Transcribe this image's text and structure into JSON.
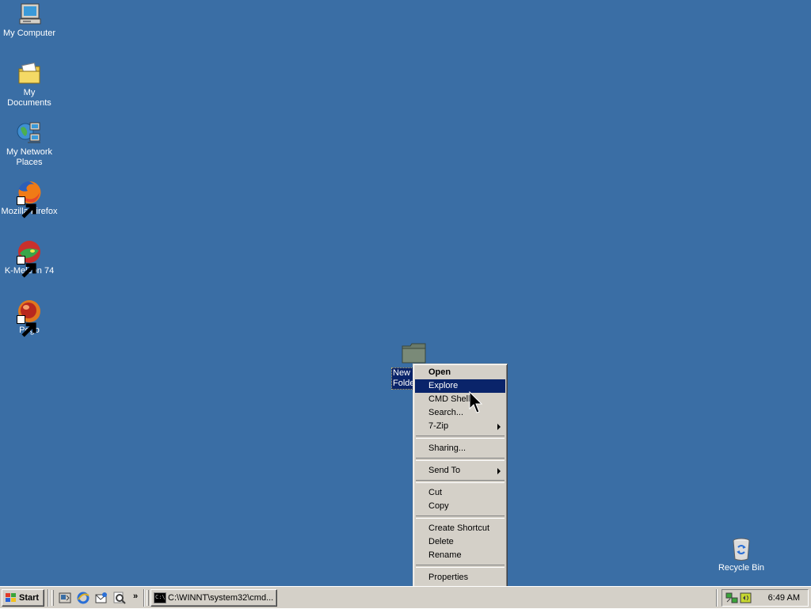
{
  "desktop": {
    "background": "#3a6ea5",
    "icons": [
      {
        "label": "My Computer",
        "icon": "computer-icon"
      },
      {
        "label": "My Documents",
        "icon": "documents-folder-icon"
      },
      {
        "label": "My Network Places",
        "icon": "network-places-icon"
      },
      {
        "label": "Mozilla Firefox",
        "icon": "firefox-icon",
        "shortcut": true
      },
      {
        "label": "K-Meleon 74",
        "icon": "k-meleon-icon",
        "shortcut": true
      },
      {
        "label": "Pego",
        "icon": "pego-icon",
        "shortcut": true
      }
    ],
    "selected_item": {
      "label": "New Folder",
      "icon": "folder-icon"
    },
    "recycle_bin": {
      "label": "Recycle Bin",
      "icon": "recycle-bin-icon"
    }
  },
  "context_menu": {
    "items": [
      {
        "label": "Open",
        "default": true
      },
      {
        "label": "Explore",
        "highlighted": true
      },
      {
        "label": "CMD Shell"
      },
      {
        "label": "Search..."
      },
      {
        "label": "7-Zip",
        "submenu": true
      },
      {
        "separator": true
      },
      {
        "label": "Sharing..."
      },
      {
        "separator": true
      },
      {
        "label": "Send To",
        "submenu": true
      },
      {
        "separator": true
      },
      {
        "label": "Cut"
      },
      {
        "label": "Copy"
      },
      {
        "separator": true
      },
      {
        "label": "Create Shortcut"
      },
      {
        "label": "Delete"
      },
      {
        "label": "Rename"
      },
      {
        "separator": true
      },
      {
        "label": "Properties"
      }
    ]
  },
  "taskbar": {
    "start_label": "Start",
    "quick_launch": [
      "show-desktop-icon",
      "internet-explorer-icon",
      "outlook-express-icon",
      "search-icon"
    ],
    "quick_launch_more": "»",
    "tasks": [
      {
        "label": "C:\\WINNT\\system32\\cmd...",
        "icon": "cmd-icon"
      }
    ],
    "tray_icons": [
      "network-connection-icon",
      "volume-icon"
    ],
    "clock": "6:49 AM"
  }
}
